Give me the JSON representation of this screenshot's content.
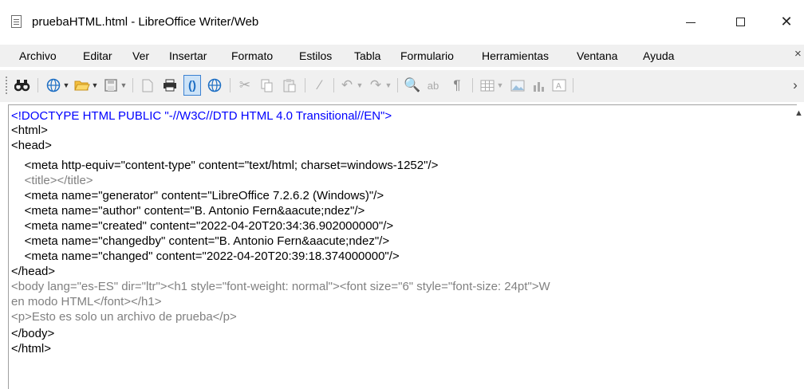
{
  "window": {
    "title": "pruebaHTML.html - LibreOffice Writer/Web",
    "icon": "writer-web-document-icon",
    "controls": {
      "minimize": "–",
      "maximize": "☐",
      "close": "✕"
    }
  },
  "menu": {
    "items": [
      "Archivo",
      "Editar",
      "Ver",
      "Insertar",
      "Formato",
      "Estilos",
      "Tabla",
      "Formulario",
      "Herramientas",
      "Ventana",
      "Ayuda"
    ],
    "overflow": "×"
  },
  "toolbar": {
    "icons": [
      "find-replace-icon",
      "web-browser-icon",
      "open-folder-icon",
      "save-icon",
      "export-pdf-icon",
      "print-icon",
      "html-source-icon",
      "web-preview-icon",
      "cut-icon",
      "copy-icon",
      "paste-icon",
      "clone-formatting-icon",
      "undo-icon",
      "redo-icon",
      "spelling-icon",
      "autocorrect-icon",
      "formatting-marks-icon",
      "insert-table-icon",
      "insert-image-icon",
      "insert-chart-icon",
      "insert-textbox-icon"
    ],
    "overflow": "›"
  },
  "colors": {
    "doctype": "#0000ff",
    "tag": "#000000",
    "comment_like": "#808080",
    "menubar_bg": "#f0f0f0"
  },
  "source": {
    "lines": [
      "<!DOCTYPE HTML PUBLIC \"-//W3C//DTD HTML 4.0 Transitional//EN\">",
      "<html>",
      "<head>",
      "    <meta http-equiv=\"content-type\" content=\"text/html; charset=windows-1252\"/>",
      "    <title></title>",
      "    <meta name=\"generator\" content=\"LibreOffice 7.2.6.2 (Windows)\"/>",
      "    <meta name=\"author\" content=\"B. Antonio Fern&aacute;ndez\"/>",
      "    <meta name=\"created\" content=\"2022-04-20T20:34:36.902000000\"/>",
      "    <meta name=\"changedby\" content=\"B. Antonio Fern&aacute;ndez\"/>",
      "    <meta name=\"changed\" content=\"2022-04-20T20:39:18.374000000\"/>",
      "</head>",
      "<body lang=\"es-ES\" dir=\"ltr\"><h1 style=\"font-weight: normal\"><font size=\"6\" style=\"font-size: 24pt\">W",
      "en modo HTML</font></h1>",
      "<p>Esto es solo un archivo de prueba</p>",
      "</body>",
      "</html>"
    ]
  }
}
